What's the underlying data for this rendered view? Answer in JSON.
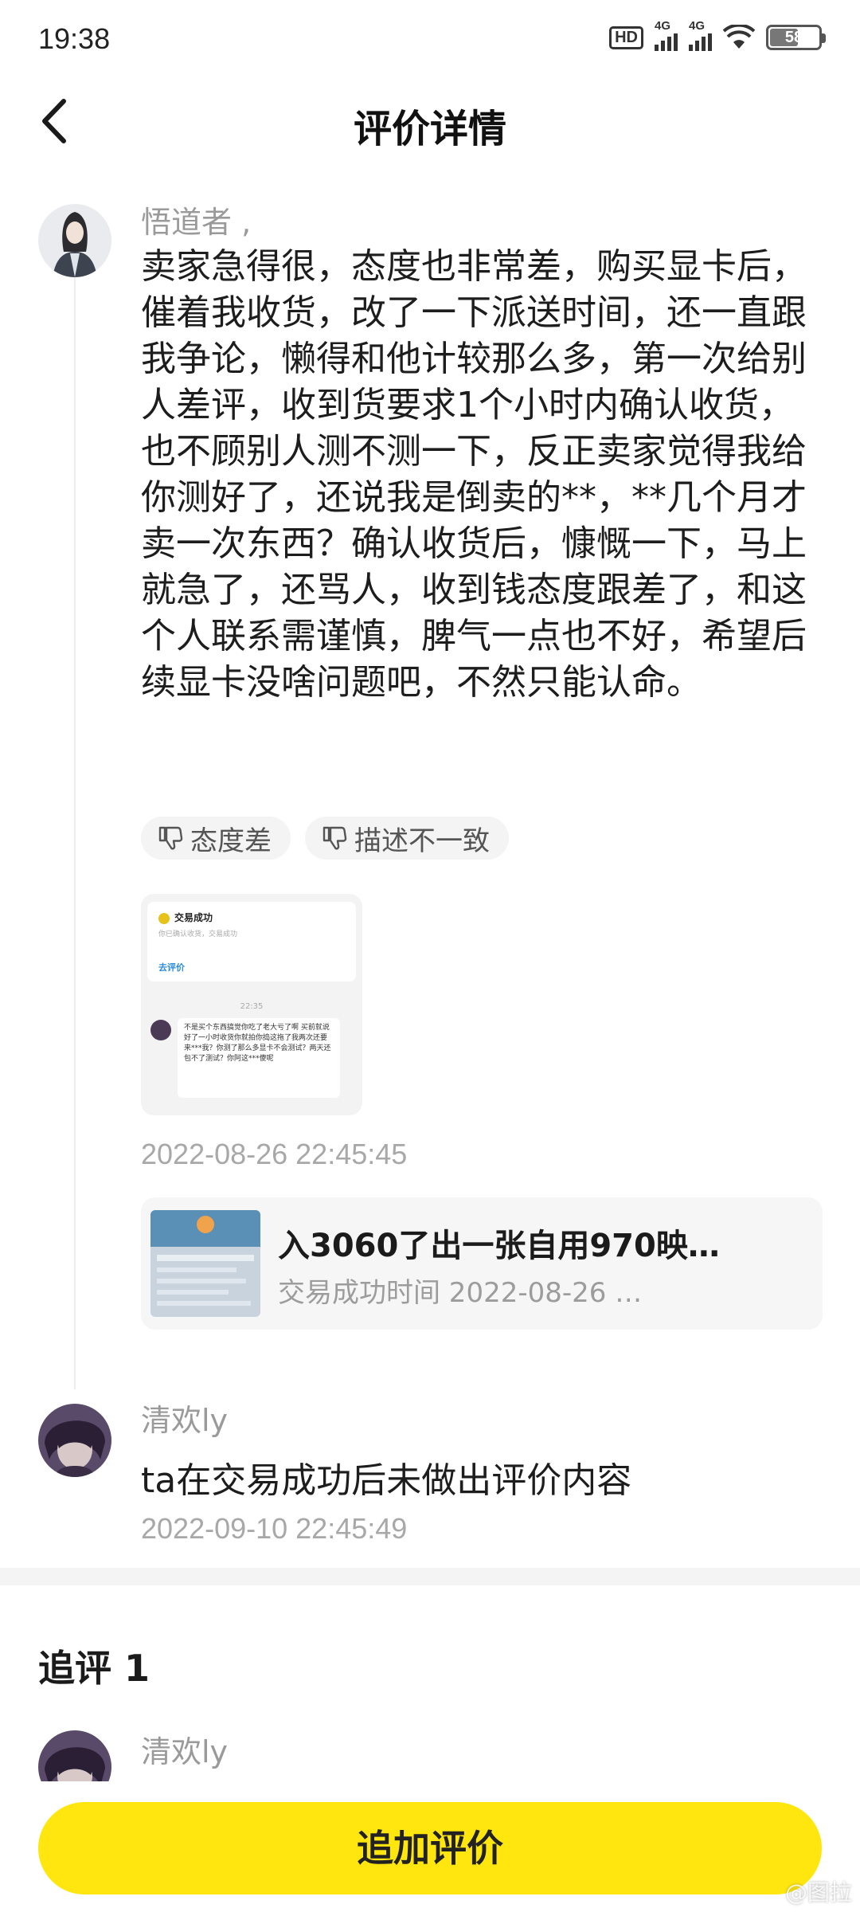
{
  "status_bar": {
    "time": "19:38",
    "hd_label": "HD",
    "network_1": "4G",
    "network_2": "4G",
    "battery": "58",
    "battery_level": 0.58
  },
  "header": {
    "title": "评价详情",
    "back_icon": "chevron-left-icon"
  },
  "review": {
    "username": "悟道者 ,",
    "text": "卖家急得很，态度也非常差，购买显卡后，催着我收货，改了一下派送时间，还一直跟我争论，懒得和他计较那么多，第一次给别人差评，收到货要求1个小时内确认收货，也不顾别人测不测一下，反正卖家觉得我给你测好了，还说我是倒卖的**，**几个月才卖一次东西？确认收货后，慷慨一下，马上就急了，还骂人，收到钱态度跟差了，和这个人联系需谨慎，脾气一点也不好，希望后续显卡没啥问题吧，不然只能认命。",
    "tags": [
      {
        "icon": "thumbs-down-icon",
        "label": "态度差"
      },
      {
        "icon": "thumbs-down-icon",
        "label": "描述不一致"
      }
    ],
    "attachment": {
      "status_title": "交易成功",
      "status_sub": "你已确认收货，交易成功",
      "action": "去评价",
      "chat_time": "22:35",
      "chat_message": "不是买个东西搞觉你吃了老大亏了啊 买前就说好了一小时收货你就拍你捣这拖了我两次还要来***我？你测了那么多显卡不会测试？两天还包不了测试？你阿这***傻呢"
    },
    "timestamp": "2022-08-26 22:45:45",
    "item": {
      "title": "入3060了出一张自用970映…",
      "subtitle": "交易成功时间 2022-08-26 …"
    }
  },
  "reply": {
    "username": "清欢ly",
    "text": "ta在交易成功后未做出评价内容",
    "timestamp": "2022-09-10 22:45:49"
  },
  "followup": {
    "title": "追评 1",
    "username": "清欢ly"
  },
  "actions": {
    "add_review": "追加评价"
  },
  "watermark": "@图拉"
}
